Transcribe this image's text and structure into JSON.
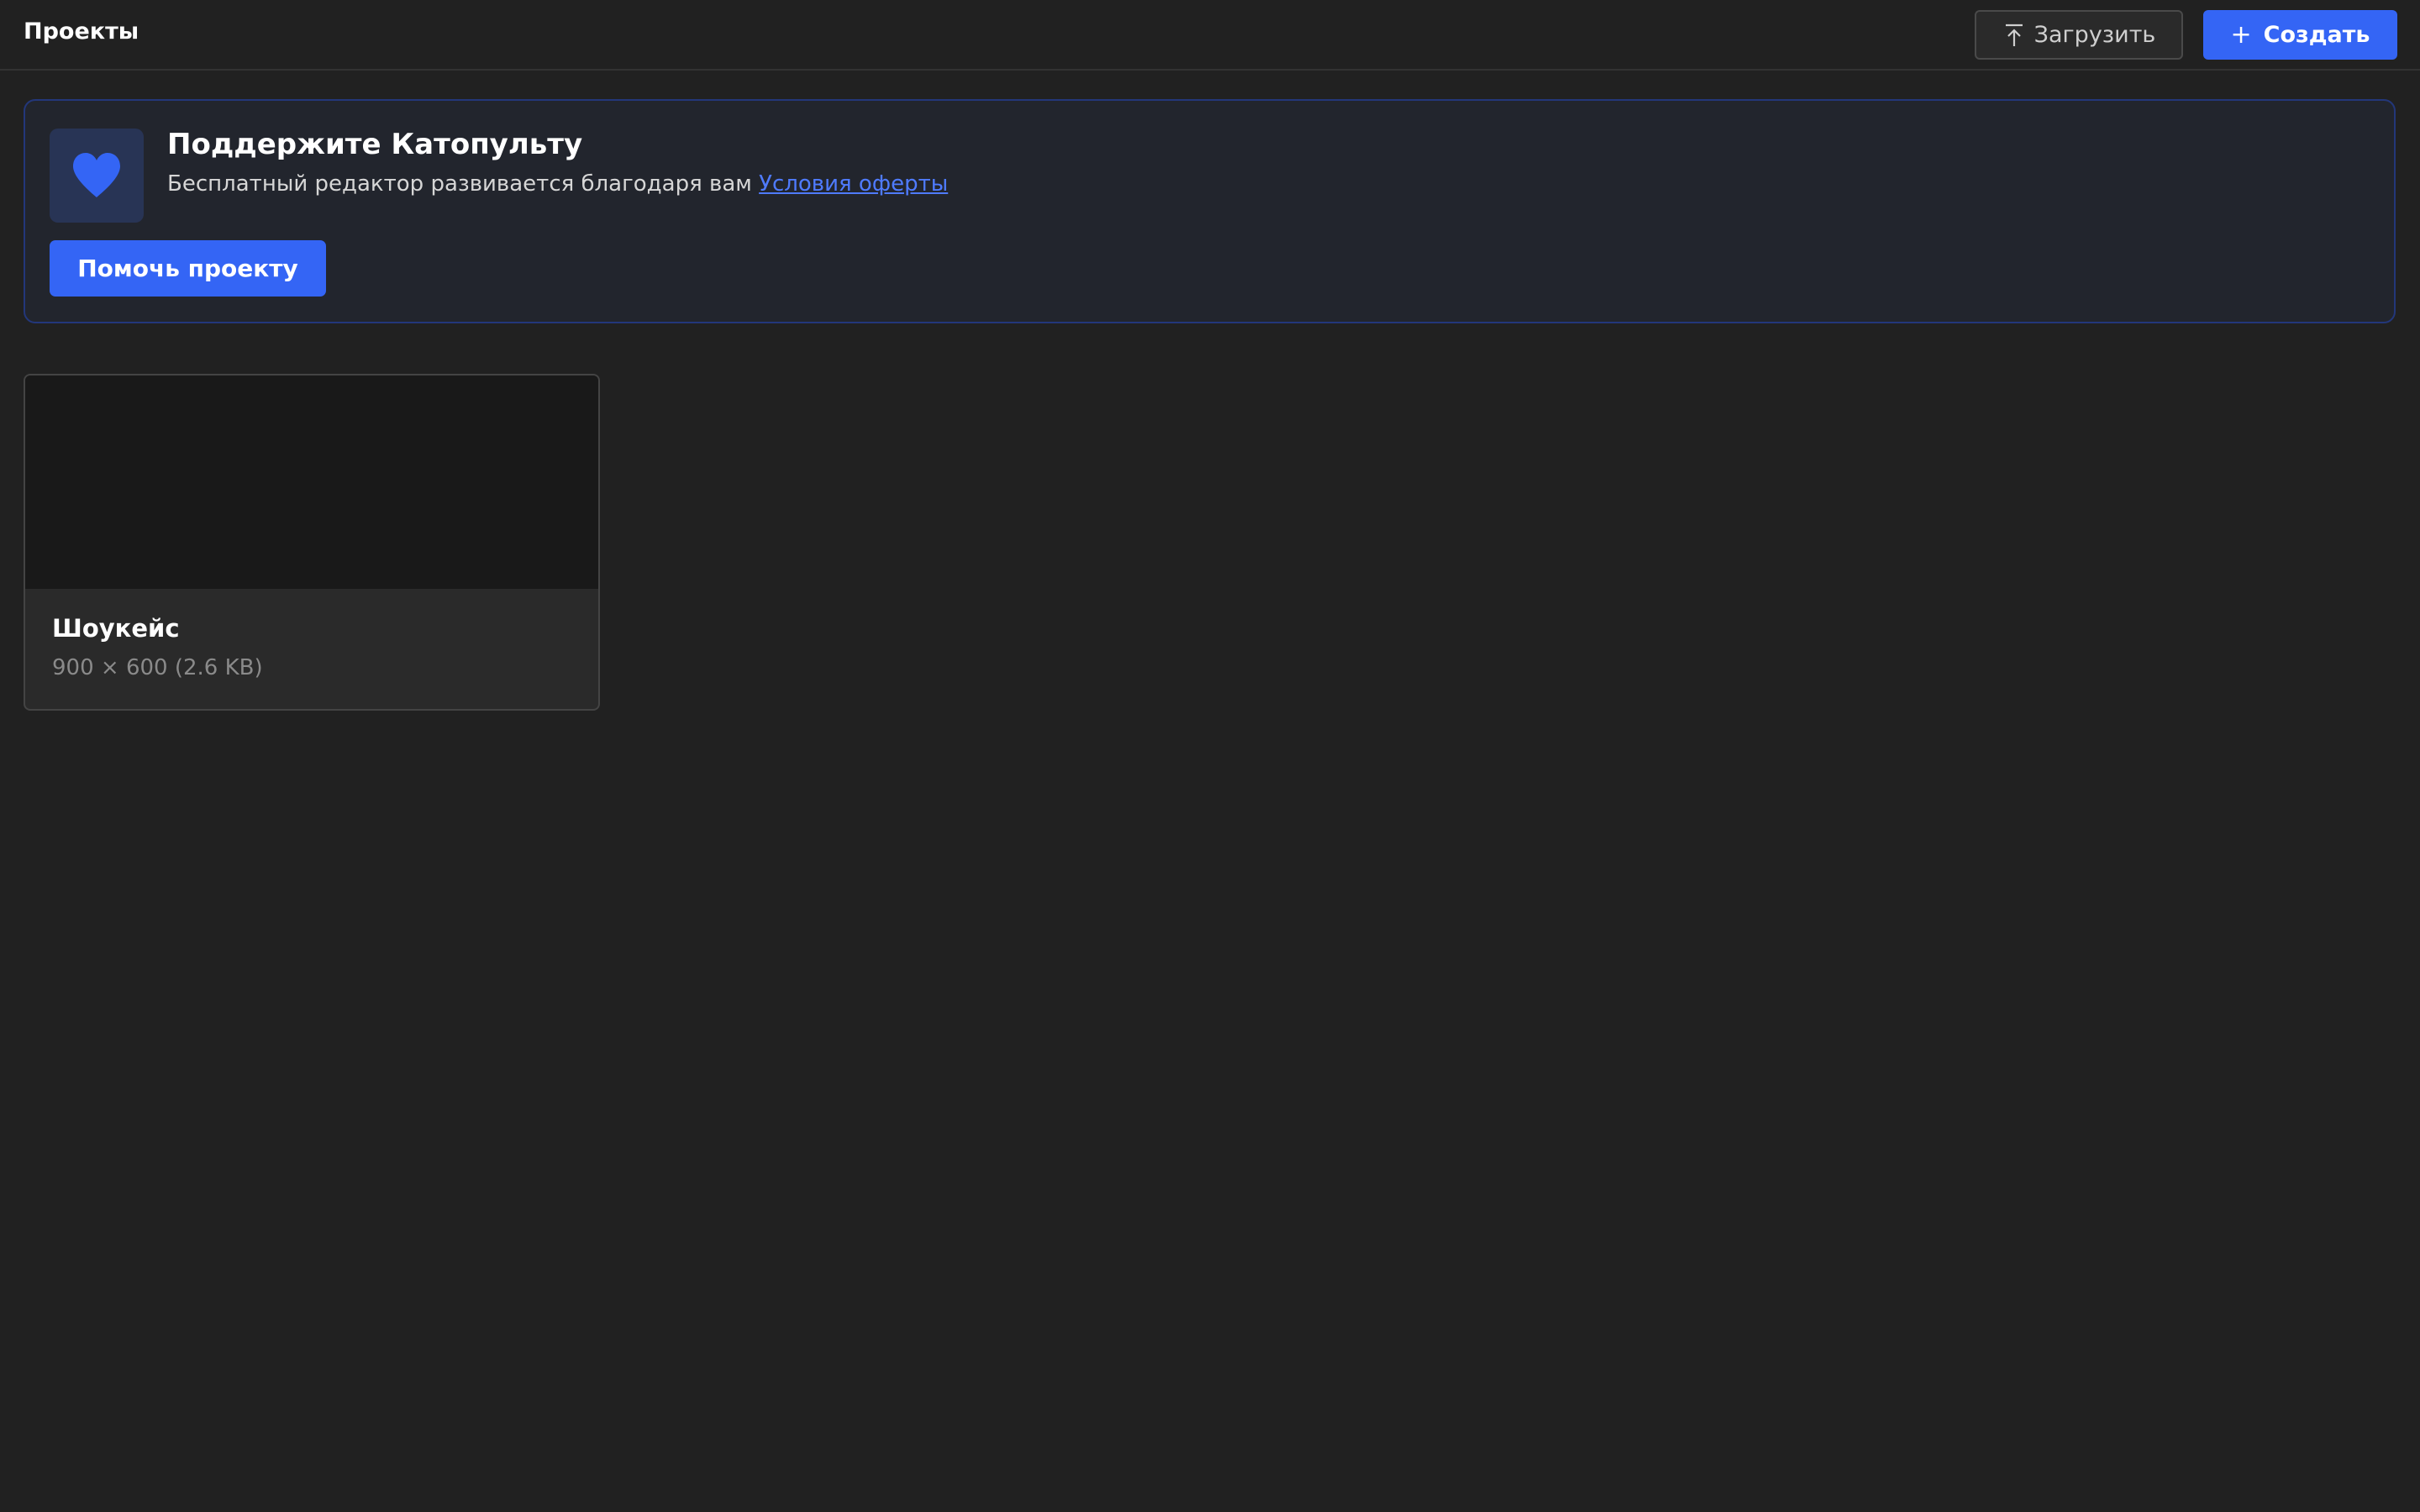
{
  "header": {
    "title": "Проекты",
    "upload_label": "Загрузить",
    "create_label": "Создать",
    "create_icon": "+"
  },
  "banner": {
    "title": "Поддержите Катопульту",
    "text": "Бесплатный редактор развивается благодаря вам",
    "link_label": "Условия оферты",
    "button_label": "Помочь проекту",
    "icon": "heart-icon"
  },
  "projects": [
    {
      "name": "Шоукейс",
      "meta": "900 × 600 (2.6 KB)"
    }
  ],
  "colors": {
    "background": "#212121",
    "accent": "#3465f5",
    "link": "#4f7bff"
  }
}
